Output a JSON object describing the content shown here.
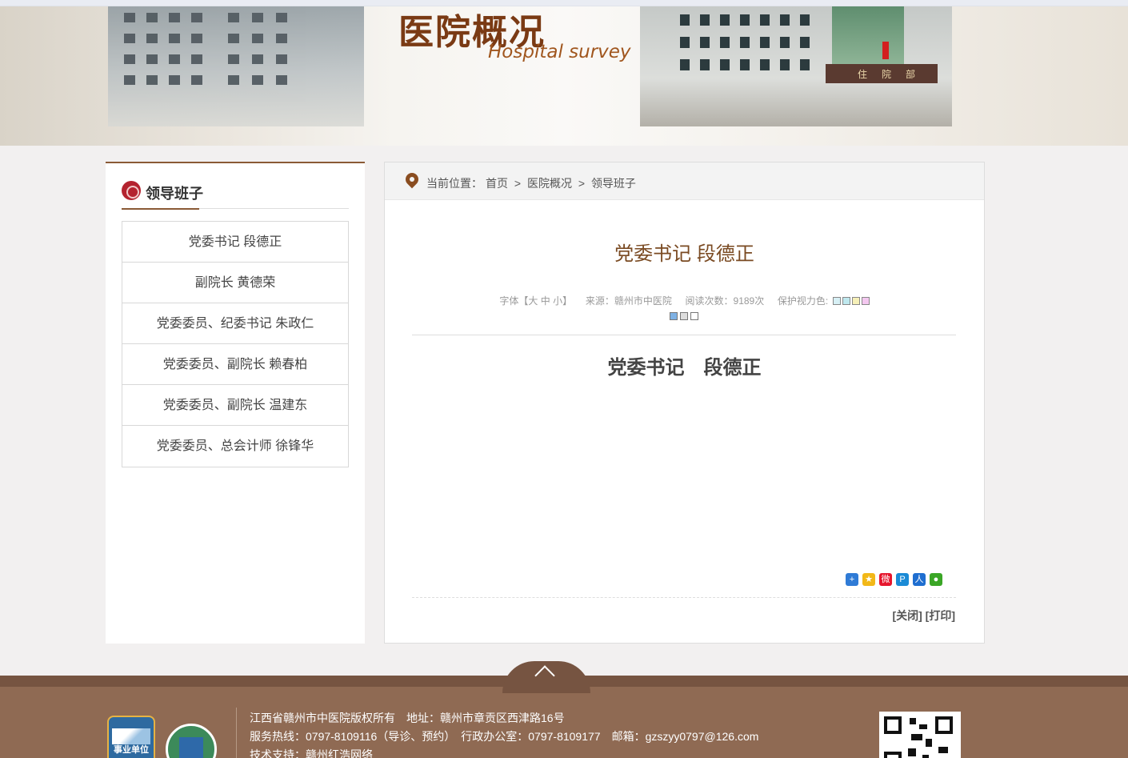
{
  "banner": {
    "title": "医院概况",
    "subtitle": "Hospital survey",
    "sign_text": "住院部"
  },
  "sidebar": {
    "heading": "领导班子",
    "items": [
      {
        "label": "党委书记 段德正"
      },
      {
        "label": "副院长 黄德荣"
      },
      {
        "label": "党委委员、纪委书记 朱政仁"
      },
      {
        "label": "党委委员、副院长 赖春柏"
      },
      {
        "label": "党委委员、副院长 温建东"
      },
      {
        "label": "党委委员、总会计师 徐锋华"
      }
    ]
  },
  "breadcrumb": {
    "prefix": "当前位置：",
    "home": "首页",
    "sep": ">",
    "section": "医院概况",
    "current": "领导班子"
  },
  "article": {
    "title": "党委书记 段德正",
    "font_label": "字体【",
    "font_large": "大",
    "font_medium": "中",
    "font_small": "小",
    "font_close": "】",
    "source": "来源：赣州市中医院",
    "views": "阅读次数：9189次",
    "eye_care": "保护视力色:",
    "body_heading": "党委书记　段德正",
    "close_label": "[关闭]",
    "print_label": "[打印]",
    "eye_colors": [
      "#d7f0f5",
      "#bfe8ee",
      "#f6f0b8",
      "#f4c8f0"
    ],
    "eye_colors_row2": [
      "#7eb1e4",
      "#dddddd",
      "#ffffff"
    ]
  },
  "footer": {
    "line1": "江西省赣州市中医院版权所有　地址：赣州市章贡区西津路16号",
    "line2": "服务热线：0797-8109116（导诊、预约）　行政办公室：0797-8109177　邮箱：gzszyy0797@126.com",
    "line3": "技术支持：赣州红浩网络",
    "badge_text": "事业单位"
  }
}
